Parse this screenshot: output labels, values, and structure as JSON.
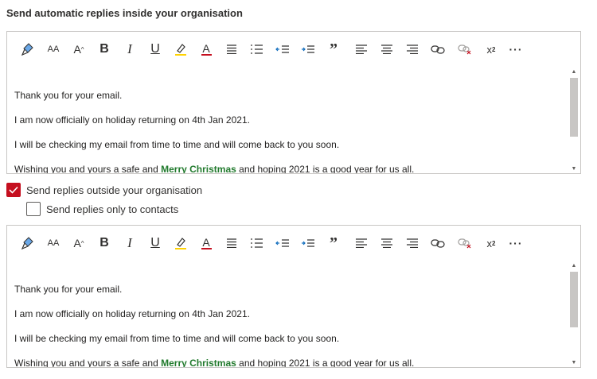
{
  "inside": {
    "title": "Send automatic replies inside your organisation"
  },
  "message": {
    "line1": "Thank you for your email.",
    "line2": "I am now officially on holiday returning on 4th Jan 2021.",
    "line3": "I will be checking my email from time to time and will come back to you soon.",
    "line4_before": "Wishing you and yours a safe and ",
    "line4_highlight": "Merry Christmas",
    "line4_after": " and hoping 2021 is a good year for us all."
  },
  "outside": {
    "checkbox_label": "Send replies outside your organisation",
    "checked": true
  },
  "contacts": {
    "checkbox_label": "Send replies only to contacts",
    "checked": false
  },
  "toolbar": {
    "font_size_glyph": "AA",
    "grow_glyph": "A",
    "bold_glyph": "B",
    "italic_glyph": "I",
    "underline_glyph": "U",
    "font_color_glyph": "A",
    "quote_glyph": "”",
    "superscript_glyph": "x",
    "superscript_mark": "2",
    "more_glyph": "···"
  },
  "colors": {
    "accent_red": "#c50f1f",
    "highlight_green": "#217a2d",
    "highlighter_yellow": "#ffd200",
    "font_color_red": "#c50f1f"
  }
}
